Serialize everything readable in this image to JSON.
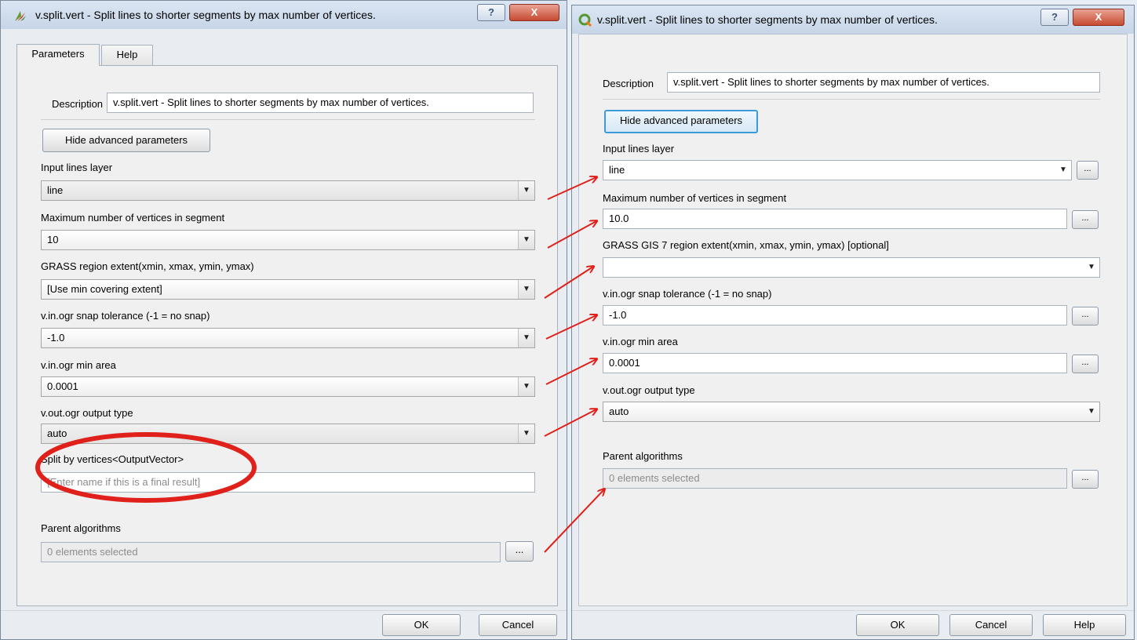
{
  "left_dialog": {
    "title": "v.split.vert - Split lines to shorter segments by max number of vertices.",
    "title_help_glyph": "?",
    "title_close_glyph": "X",
    "tabs": [
      {
        "label": "Parameters"
      },
      {
        "label": "Help"
      }
    ],
    "description_label": "Description",
    "description_value": "v.split.vert - Split lines to shorter segments by max number of vertices.",
    "hide_advanced_label": "Hide advanced parameters",
    "input_lines_label": "Input lines layer",
    "input_lines_value": "line",
    "max_vertices_label": "Maximum number of vertices in segment",
    "max_vertices_value": "10",
    "region_label": "GRASS region extent(xmin, xmax, ymin, ymax)",
    "region_value": "[Use min covering extent]",
    "snap_label": "v.in.ogr snap tolerance (-1 = no snap)",
    "snap_value": "-1.0",
    "min_area_label": "v.in.ogr min area",
    "min_area_value": "0.0001",
    "output_type_label": "v.out.ogr output type",
    "output_type_value": "auto",
    "split_output_label": "Split by vertices<OutputVector>",
    "split_output_placeholder": "[Enter name if this is a final result]",
    "parent_label": "Parent algorithms",
    "parent_value": "0 elements selected",
    "parent_btn": "...",
    "ok_label": "OK",
    "cancel_label": "Cancel",
    "dropdown_glyph": "▼"
  },
  "right_dialog": {
    "title": "v.split.vert - Split lines to shorter segments by max number of vertices.",
    "title_help_glyph": "?",
    "title_close_glyph": "X",
    "description_label": "Description",
    "description_value": "v.split.vert - Split lines to shorter segments by max number of vertices.",
    "hide_advanced_label": "Hide advanced parameters",
    "input_lines_label": "Input lines layer",
    "input_lines_value": "line",
    "max_vertices_label": "Maximum number of vertices in segment",
    "max_vertices_value": "10.0",
    "region_label": "GRASS GIS 7 region extent(xmin, xmax, ymin, ymax) [optional]",
    "region_value": "",
    "snap_label": "v.in.ogr snap tolerance (-1 = no snap)",
    "snap_value": "-1.0",
    "min_area_label": "v.in.ogr min area",
    "min_area_value": "0.0001",
    "output_type_label": "v.out.ogr output type",
    "output_type_value": "auto",
    "parent_label": "Parent algorithms",
    "parent_value": "0 elements selected",
    "ellipsis_btn": "...",
    "ok_label": "OK",
    "cancel_label": "Cancel",
    "help_label": "Help",
    "dropdown_glyph": "▼"
  },
  "colors": {
    "annotation_red": "#e0201a",
    "focus_blue": "#3c9ad8",
    "qgis_green": "#589632"
  }
}
